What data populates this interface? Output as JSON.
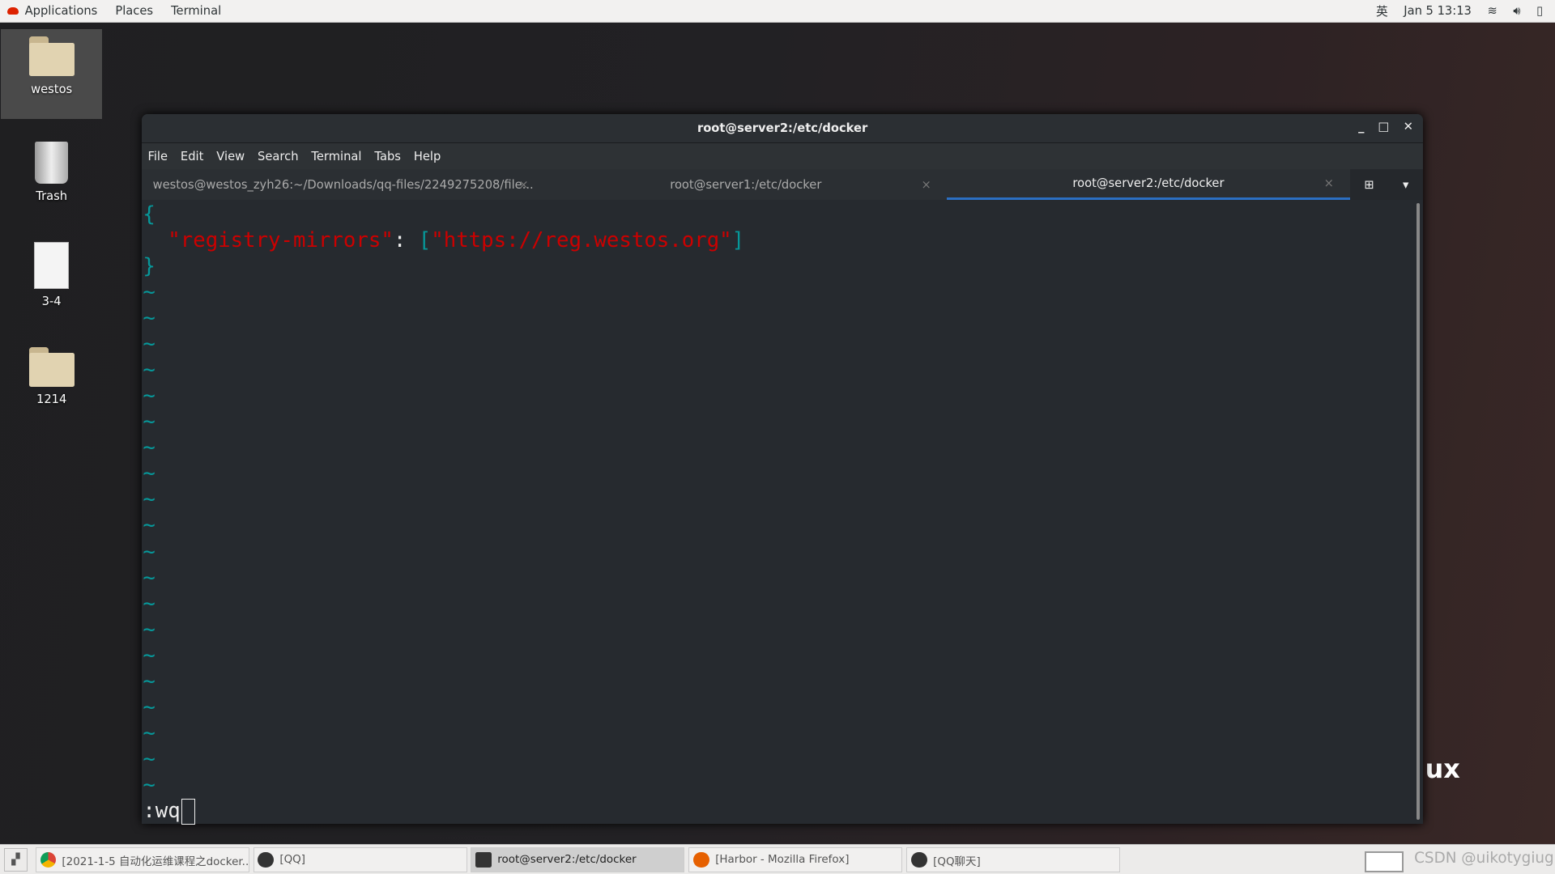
{
  "topbar": {
    "applications": "Applications",
    "places": "Places",
    "terminal": "Terminal",
    "input_method": "英",
    "datetime": "Jan 5  13:13",
    "icons": [
      "wifi-icon",
      "volume-icon",
      "battery-icon"
    ]
  },
  "desktop": [
    {
      "label": "westos",
      "icon": "home-folder-icon"
    },
    {
      "label": "Trash",
      "icon": "trash-icon"
    },
    {
      "label": "3-4",
      "icon": "document-icon"
    },
    {
      "label": "1214",
      "icon": "folder-icon"
    }
  ],
  "window": {
    "title": "root@server2:/etc/docker",
    "menu": [
      "File",
      "Edit",
      "View",
      "Search",
      "Terminal",
      "Tabs",
      "Help"
    ],
    "tabs": [
      {
        "label": "westos@westos_zyh26:~/Downloads/qq-files/2249275208/file...",
        "active": false
      },
      {
        "label": "root@server1:/etc/docker",
        "active": false
      },
      {
        "label": "root@server2:/etc/docker",
        "active": true
      }
    ],
    "terminal": {
      "line1": "{",
      "key": "\"registry-mirrors\"",
      "colon": ": ",
      "open": "[",
      "value": "\"https://reg.westos.org\"",
      "close": "]",
      "line3": "}",
      "tilde": "~",
      "command": ":wq"
    }
  },
  "watermark_partial": "ux",
  "taskbar": {
    "items": [
      {
        "label": "[2021-1-5 自动化运维课程之docker...",
        "active": false
      },
      {
        "label": "[QQ]",
        "active": false
      },
      {
        "label": "root@server2:/etc/docker",
        "active": true
      },
      {
        "label": "[Harbor - Mozilla Firefox]",
        "active": false
      },
      {
        "label": "[QQ聊天]",
        "active": false
      }
    ],
    "overlay": "CSDN @uikotygiug"
  },
  "colors": {
    "accent": "#2b6fc2",
    "json_key": "#cc0000",
    "bracket": "#06989a"
  }
}
